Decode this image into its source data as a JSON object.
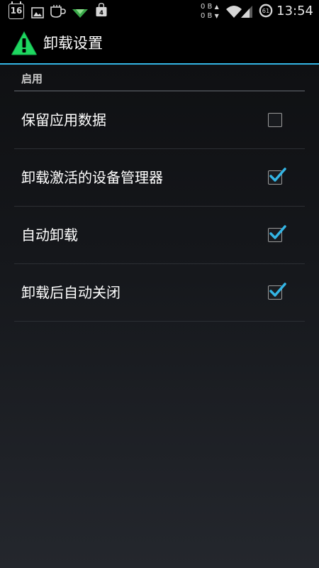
{
  "status_bar": {
    "notification_icons": [
      "calendar-icon",
      "image-icon",
      "cup-icon",
      "download-icon",
      "store-icon"
    ],
    "calendar_day": "16",
    "store_badge": "4",
    "traffic_up": "0 B",
    "traffic_down": "0 B",
    "battery_level": "61",
    "time": "13:54"
  },
  "action_bar": {
    "title": "卸载设置",
    "icon": "warning-icon",
    "icon_color": "#1ed760"
  },
  "section": {
    "header": "启用"
  },
  "preferences": [
    {
      "label": "保留应用数据",
      "checked": false
    },
    {
      "label": "卸载激活的设备管理器",
      "checked": true
    },
    {
      "label": "自动卸载",
      "checked": true
    },
    {
      "label": "卸载后自动关闭",
      "checked": true
    }
  ],
  "colors": {
    "accent": "#33b5e5",
    "check": "#33b5e5"
  }
}
